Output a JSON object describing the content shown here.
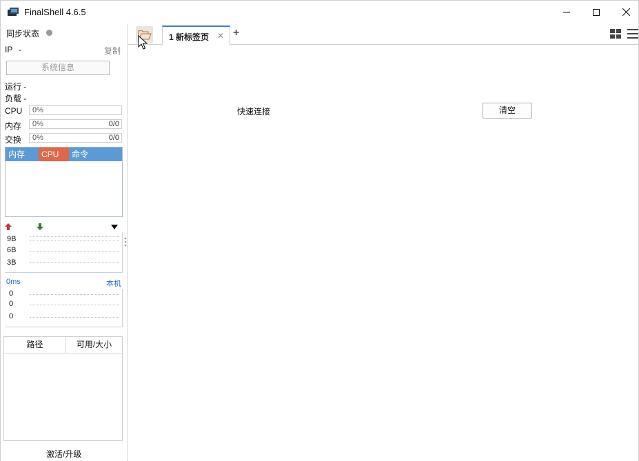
{
  "window": {
    "title": "FinalShell 4.6.5"
  },
  "left_panel": {
    "sync_status_label": "同步状态",
    "ip_label": "IP",
    "ip_value": "-",
    "copy_label": "复制",
    "system_info_button": "系统信息",
    "running_label": "运行 -",
    "load_label": "负载 -",
    "meters": [
      {
        "label": "CPU",
        "percent": "0%",
        "ratio": ""
      },
      {
        "label": "内存",
        "percent": "0%",
        "ratio": "0/0"
      },
      {
        "label": "交换",
        "percent": "0%",
        "ratio": "0/0"
      }
    ],
    "process_table": {
      "headers": [
        "内存",
        "CPU",
        "命令"
      ],
      "header_colors": {
        "default": "#5b9bd5",
        "cpu": "#e0674a"
      }
    },
    "network": {
      "ticks": [
        "9B",
        "6B",
        "3B"
      ]
    },
    "latency": {
      "left_label": "0ms",
      "right_label": "本机",
      "ticks": [
        "0",
        "0",
        "0"
      ]
    },
    "filesystem_table": {
      "headers": [
        "路径",
        "可用/大小"
      ]
    },
    "activate_link": "激活/升级"
  },
  "tabs": {
    "items": [
      {
        "label": "1 新标签页",
        "active": true
      }
    ]
  },
  "main": {
    "quick_connect_label": "快速连接",
    "clear_button": "清空"
  },
  "colors": {
    "accent": "#3a7bd5",
    "folder_icon": "#d9823b",
    "upload_arrow": "#c0392b",
    "download_arrow": "#2e7d32",
    "link_blue": "#2a6db0"
  }
}
